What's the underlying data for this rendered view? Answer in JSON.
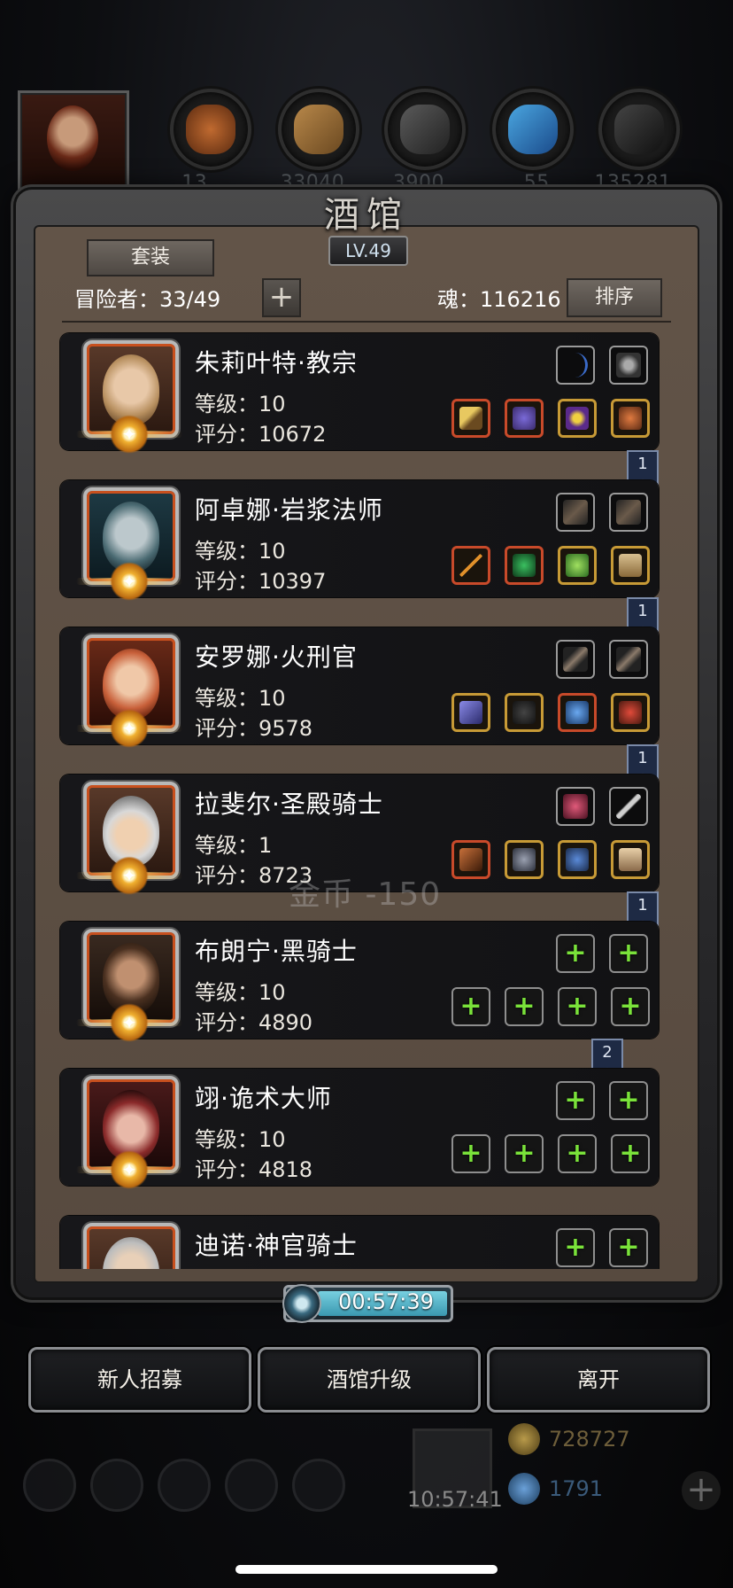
{
  "header": {
    "resources": [
      "13...",
      "33040",
      "3900",
      "...55",
      "135281"
    ]
  },
  "dialog": {
    "title": "酒馆",
    "level": "LV.49",
    "set_button": "套装",
    "adventurers": "冒险者：33/49",
    "add_icon": "+",
    "soul": "魂：116216",
    "sort_button": "排序"
  },
  "heroes": [
    {
      "name": "朱莉叶特·教宗",
      "level": "等级：10",
      "score": "评分：10672",
      "bookmark": "1"
    },
    {
      "name": "阿卓娜·岩浆法师",
      "level": "等级：10",
      "score": "评分：10397",
      "bookmark": "1"
    },
    {
      "name": "安罗娜·火刑官",
      "level": "等级：10",
      "score": "评分：9578",
      "bookmark": "1"
    },
    {
      "name": "拉斐尔·圣殿骑士",
      "level": "等级：1",
      "score": "评分：8723",
      "bookmark": "1"
    },
    {
      "name": "布朗宁·黑骑士",
      "level": "等级：10",
      "score": "评分：4890",
      "bookmark": "2"
    },
    {
      "name": "翊·诡术大师",
      "level": "等级：10",
      "score": "评分：4818",
      "bookmark": ""
    },
    {
      "name": "迪诺·神官骑士",
      "level": "",
      "score": "",
      "bookmark": ""
    }
  ],
  "floating_text": "金币 -150",
  "timer": "00:57:39",
  "buttons": {
    "recruit": "新人招募",
    "upgrade": "酒馆升级",
    "leave": "离开"
  },
  "bottom": {
    "gold": "728727",
    "gems": "1791",
    "gift_timer": "10:57:41"
  },
  "colors": {
    "card_bg": "#141416",
    "frame_border": "#3a3a3a",
    "gold_slot": "#c79a36",
    "green_plus": "#7ae23a",
    "timer_fill": "#5ab4c8"
  }
}
